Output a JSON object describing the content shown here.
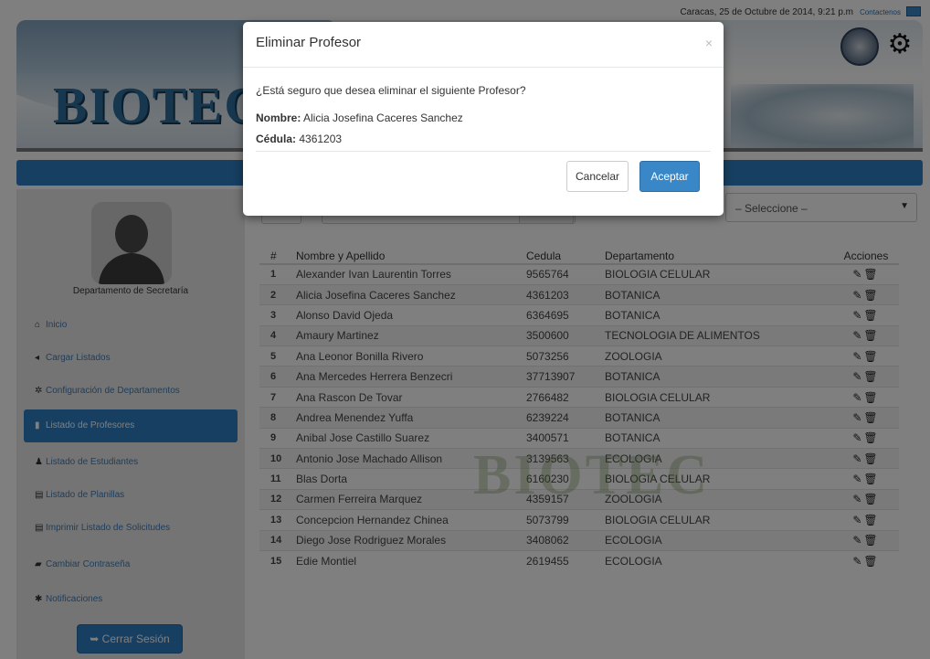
{
  "topbar": {
    "date": "Caracas, 25 de Octubre de 2014, 9:21 p.m",
    "contact": "Contactenos",
    "mail_icon": "envelope-icon"
  },
  "banner": {
    "logo_part1": "BIO",
    "logo_part2": "TEC"
  },
  "sidebar": {
    "dept_label": "Departamento de Secretaría",
    "items": [
      {
        "label": "Inicio",
        "icon": "home-icon"
      },
      {
        "label": "Cargar Listados",
        "icon": "send-icon"
      },
      {
        "label": "Configuración de Departamentos",
        "icon": "gear-icon"
      },
      {
        "label": "Listado de Profesores",
        "icon": "book-icon"
      },
      {
        "label": "Listado de Estudiantes",
        "icon": "user-icon"
      },
      {
        "label": "Listado de Planillas",
        "icon": "list-icon"
      },
      {
        "label": "Imprimir Listado de Solicitudes",
        "icon": "list-icon"
      },
      {
        "label": "Cambiar Contraseña",
        "icon": "lock-icon"
      },
      {
        "label": "Notificaciones",
        "icon": "asterisk-icon"
      }
    ],
    "logout": "Cerrar Sesión"
  },
  "filters": {
    "department_select": "– Seleccione –"
  },
  "table": {
    "headers": {
      "num": "#",
      "name": "Nombre y Apellido",
      "cedula": "Cedula",
      "dept": "Departamento",
      "actions": "Acciones"
    },
    "rows": [
      {
        "num": "1",
        "name": "Alexander Ivan Laurentin Torres",
        "cedula": "9565764",
        "dept": "BIOLOGIA CELULAR"
      },
      {
        "num": "2",
        "name": "Alicia Josefina Caceres Sanchez",
        "cedula": "4361203",
        "dept": "BOTANICA"
      },
      {
        "num": "3",
        "name": "Alonso David Ojeda",
        "cedula": "6364695",
        "dept": "BOTANICA"
      },
      {
        "num": "4",
        "name": "Amaury Martinez",
        "cedula": "3500600",
        "dept": "TECNOLOGIA DE ALIMENTOS"
      },
      {
        "num": "5",
        "name": "Ana Leonor Bonilla Rivero",
        "cedula": "5073256",
        "dept": "ZOOLOGIA"
      },
      {
        "num": "6",
        "name": "Ana Mercedes Herrera Benzecri",
        "cedula": "37713907",
        "dept": "BOTANICA"
      },
      {
        "num": "7",
        "name": "Ana Rascon De Tovar",
        "cedula": "2766482",
        "dept": "BIOLOGIA CELULAR"
      },
      {
        "num": "8",
        "name": "Andrea Menendez Yuffa",
        "cedula": "6239224",
        "dept": "BOTANICA"
      },
      {
        "num": "9",
        "name": "Anibal Jose Castillo Suarez",
        "cedula": "3400571",
        "dept": "BOTANICA"
      },
      {
        "num": "10",
        "name": "Antonio Jose Machado Allison",
        "cedula": "3139563",
        "dept": "ECOLOGIA"
      },
      {
        "num": "11",
        "name": "Blas Dorta",
        "cedula": "6160230",
        "dept": "BIOLOGIA CELULAR"
      },
      {
        "num": "12",
        "name": "Carmen Ferreira Marquez",
        "cedula": "4359157",
        "dept": "ZOOLOGIA"
      },
      {
        "num": "13",
        "name": "Concepcion Hernandez Chinea",
        "cedula": "5073799",
        "dept": "BIOLOGIA CELULAR"
      },
      {
        "num": "14",
        "name": "Diego Jose Rodriguez Morales",
        "cedula": "3408062",
        "dept": "ECOLOGIA"
      },
      {
        "num": "15",
        "name": "Edie Montiel",
        "cedula": "2619455",
        "dept": "ECOLOGIA"
      }
    ]
  },
  "watermark": "BIOTEC",
  "modal": {
    "title": "Eliminar Profesor",
    "close": "×",
    "question": "¿Está seguro que desea eliminar el siguiente Profesor?",
    "name_label": "Nombre:",
    "name_value": "Alicia Josefina Caceres Sanchez",
    "ced_label": "Cédula:",
    "ced_value": "4361203",
    "cancel": "Cancelar",
    "accept": "Aceptar"
  },
  "colors": {
    "accent": "#2f7ec2",
    "primary_button": "#3a87c8",
    "backdrop": "rgba(0,0,0,0.5)"
  }
}
